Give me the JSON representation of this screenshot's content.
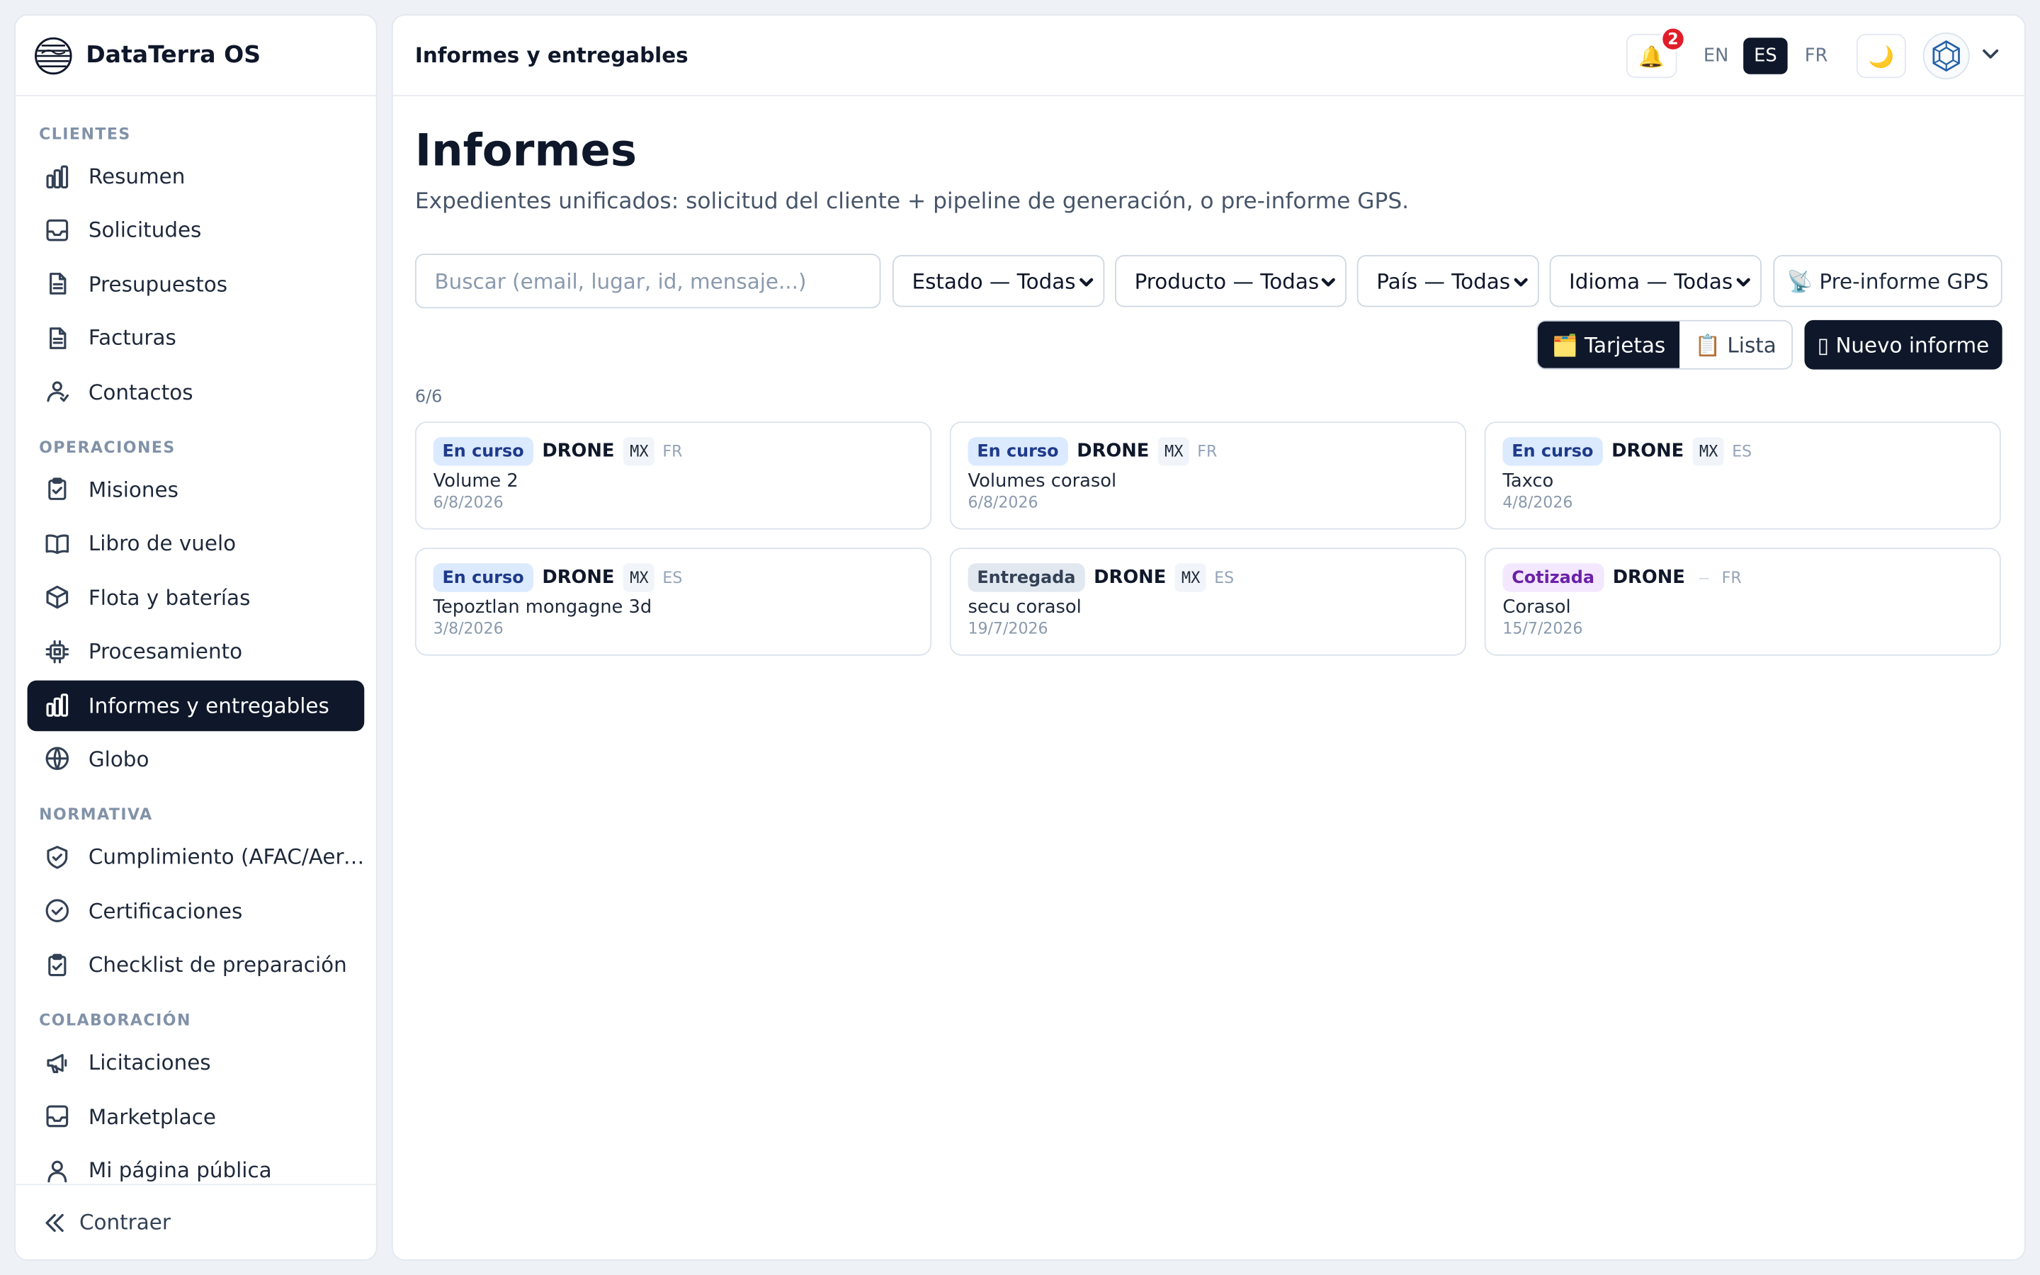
{
  "brand": {
    "name": "DataTerra OS"
  },
  "sidebar": {
    "sections": [
      {
        "title": "CLIENTES",
        "items": [
          {
            "label": "Resumen",
            "icon": "bar-chart-icon"
          },
          {
            "label": "Solicitudes",
            "icon": "inbox-icon"
          },
          {
            "label": "Presupuestos",
            "icon": "document-icon"
          },
          {
            "label": "Facturas",
            "icon": "document-icon"
          },
          {
            "label": "Contactos",
            "icon": "contacts-icon"
          }
        ]
      },
      {
        "title": "OPERACIONES",
        "items": [
          {
            "label": "Misiones",
            "icon": "clipboard-icon"
          },
          {
            "label": "Libro de vuelo",
            "icon": "book-icon"
          },
          {
            "label": "Flota y baterías",
            "icon": "box-icon"
          },
          {
            "label": "Procesamiento",
            "icon": "cpu-icon"
          },
          {
            "label": "Informes y entregables",
            "icon": "bar-chart-icon",
            "active": true
          },
          {
            "label": "Globo",
            "icon": "globe-icon"
          }
        ]
      },
      {
        "title": "NORMATIVA",
        "items": [
          {
            "label": "Cumplimiento (AFAC/AeroMéxico)",
            "icon": "shield-check-icon"
          },
          {
            "label": "Certificaciones",
            "icon": "check-circle-icon"
          },
          {
            "label": "Checklist de preparación",
            "icon": "clipboard-check-icon"
          }
        ]
      },
      {
        "title": "COLABORACIÓN",
        "items": [
          {
            "label": "Licitaciones",
            "icon": "megaphone-icon"
          },
          {
            "label": "Marketplace",
            "icon": "inbox-icon"
          },
          {
            "label": "Mi página pública",
            "icon": "user-icon"
          }
        ]
      }
    ],
    "collapse_label": "Contraer"
  },
  "topbar": {
    "title": "Informes y entregables",
    "notifications_count": "2",
    "bell_glyph": "🔔",
    "languages": [
      {
        "code": "EN",
        "active": false
      },
      {
        "code": "ES",
        "active": true
      },
      {
        "code": "FR",
        "active": false
      }
    ],
    "theme_glyph": "🌙"
  },
  "page": {
    "title": "Informes",
    "subtitle": "Expedientes unificados: solicitud del cliente + pipeline de generación, o pre-informe GPS."
  },
  "filters": {
    "search_placeholder": "Buscar (email, lugar, id, mensaje...)",
    "estado": "Estado — Todas",
    "producto": "Producto — Todas",
    "pais": "País — Todas",
    "idioma": "Idioma — Todas",
    "gps_button": "📡 Pre-informe GPS"
  },
  "view_toggle": {
    "cards": "🗂️ Tarjetas",
    "list": "📋 Lista"
  },
  "new_report": "▯ Nuevo informe",
  "results_count": "6/6",
  "reports": [
    {
      "status": "En curso",
      "status_kind": "progress",
      "product": "DRONE",
      "country": "MX",
      "lang": "FR",
      "title": "Volume 2",
      "date": "6/8/2026"
    },
    {
      "status": "En curso",
      "status_kind": "progress",
      "product": "DRONE",
      "country": "MX",
      "lang": "FR",
      "title": "Volumes corasol",
      "date": "6/8/2026"
    },
    {
      "status": "En curso",
      "status_kind": "progress",
      "product": "DRONE",
      "country": "MX",
      "lang": "ES",
      "title": "Taxco",
      "date": "4/8/2026"
    },
    {
      "status": "En curso",
      "status_kind": "progress",
      "product": "DRONE",
      "country": "MX",
      "lang": "ES",
      "title": "Tepoztlan mongagne 3d",
      "date": "3/8/2026"
    },
    {
      "status": "Entregada",
      "status_kind": "delivered",
      "product": "DRONE",
      "country": "MX",
      "lang": "ES",
      "title": "secu corasol",
      "date": "19/7/2026"
    },
    {
      "status": "Cotizada",
      "status_kind": "quoted",
      "product": "DRONE",
      "country": "–",
      "lang": "FR",
      "title": "Corasol",
      "date": "15/7/2026"
    }
  ],
  "colors": {
    "primary": "#0f172a",
    "notification": "#e11d2a",
    "progress_bg": "#dbeafe",
    "delivered_bg": "#e2e8f0",
    "quoted_bg": "#f3e8ff"
  }
}
